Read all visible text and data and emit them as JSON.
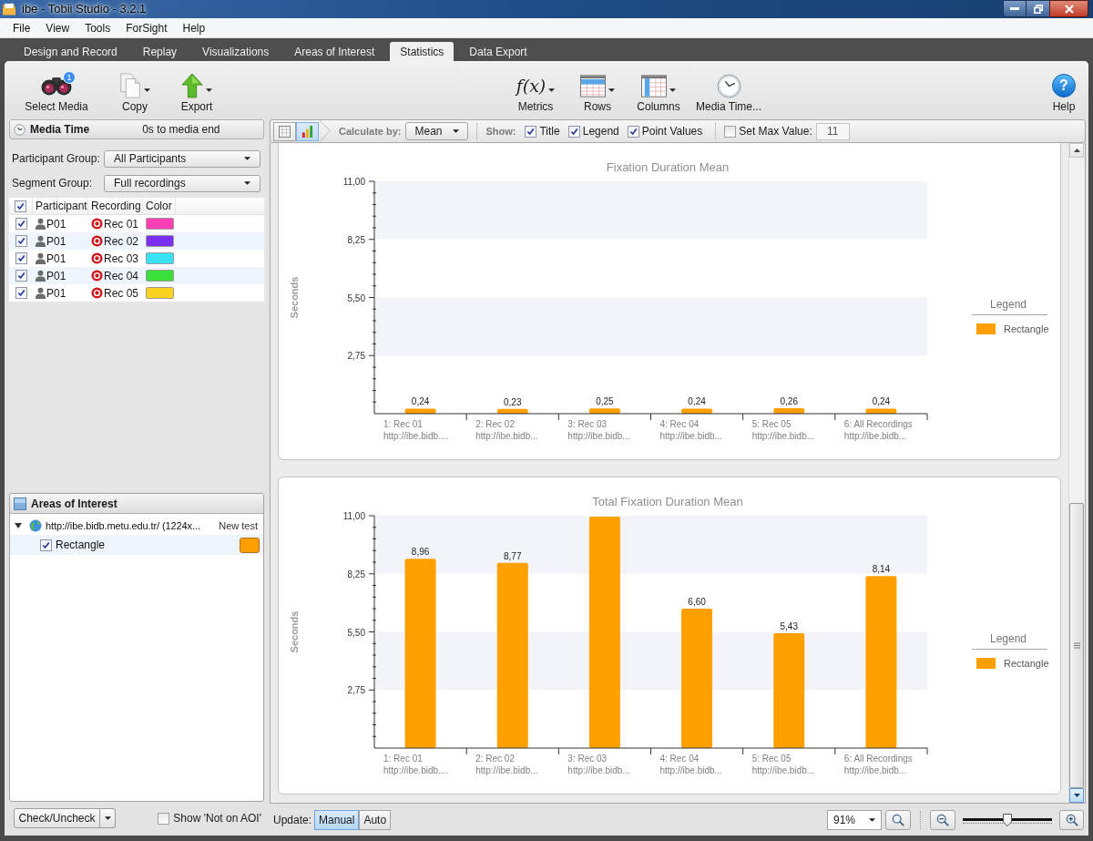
{
  "window": {
    "title": "ibe - Tobii Studio - 3.2.1"
  },
  "menu": [
    "File",
    "View",
    "Tools",
    "ForSight",
    "Help"
  ],
  "tabs": [
    {
      "label": "Design and Record",
      "selected": false
    },
    {
      "label": "Replay",
      "selected": false
    },
    {
      "label": "Visualizations",
      "selected": false
    },
    {
      "label": "Areas of Interest",
      "selected": false
    },
    {
      "label": "Statistics",
      "selected": true
    },
    {
      "label": "Data Export",
      "selected": false
    }
  ],
  "toolbar": {
    "left": [
      {
        "kind": "binoculars",
        "label": "Select Media",
        "badge": "1",
        "dropdown": false
      },
      {
        "kind": "pages",
        "label": "Copy",
        "dropdown": true
      },
      {
        "kind": "up-arrow",
        "label": "Export",
        "dropdown": true
      }
    ],
    "center": [
      {
        "kind": "formula",
        "label": "Metrics",
        "glyph": "f(x)",
        "dropdown": true
      },
      {
        "kind": "rows",
        "label": "Rows",
        "dropdown": true
      },
      {
        "kind": "columns",
        "label": "Columns",
        "dropdown": true
      },
      {
        "kind": "clock",
        "label": "Media Time...",
        "dropdown": false
      }
    ],
    "right": [
      {
        "kind": "help",
        "label": "Help",
        "glyph": "?",
        "dropdown": false
      }
    ]
  },
  "media_time": {
    "title": "Media Time",
    "range": "0s to media end"
  },
  "filters": [
    {
      "label": "Participant Group:",
      "value": "All Participants"
    },
    {
      "label": "Segment Group:",
      "value": "Full recordings"
    }
  ],
  "recordings_table": {
    "all_checked": true,
    "columns": [
      "Participant",
      "Recording",
      "Color"
    ],
    "rows": [
      {
        "checked": true,
        "participant": "P01",
        "recording": "Rec 01",
        "color": "#ff40b4"
      },
      {
        "checked": true,
        "participant": "P01",
        "recording": "Rec 02",
        "color": "#7b2ff0"
      },
      {
        "checked": true,
        "participant": "P01",
        "recording": "Rec 03",
        "color": "#38e4f4"
      },
      {
        "checked": true,
        "participant": "P01",
        "recording": "Rec 04",
        "color": "#3ae03a"
      },
      {
        "checked": true,
        "participant": "P01",
        "recording": "Rec 05",
        "color": "#ffd21e"
      }
    ]
  },
  "aoi_panel": {
    "title": "Areas of Interest",
    "tree": [
      {
        "label": "http://ibe.bidb.metu.edu.tr/ (1224x...",
        "test": "New test",
        "expanded": true,
        "children": [
          {
            "label": "Rectangle",
            "checked": true,
            "selected": true,
            "color": "#ffa000"
          }
        ]
      }
    ]
  },
  "left_footer": {
    "button": "Check/Uncheck",
    "option": {
      "label": "Show 'Not on AOI'",
      "checked": false
    }
  },
  "options_bar": {
    "views": [
      {
        "kind": "table",
        "selected": false
      },
      {
        "kind": "chart",
        "selected": true
      }
    ],
    "calculate_by": {
      "label": "Calculate by:",
      "value": "Mean"
    },
    "show": {
      "label": "Show:",
      "options": [
        {
          "label": "Title",
          "checked": true
        },
        {
          "label": "Legend",
          "checked": true
        },
        {
          "label": "Point Values",
          "checked": true
        }
      ]
    },
    "max_value": {
      "label": "Set Max Value:",
      "checked": false,
      "value": "11"
    }
  },
  "charts": [
    {
      "legend_title": "Legend",
      "chart_data": {
        "type": "bar",
        "title": "Fixation Duration Mean",
        "ylabel": "Seconds",
        "categories": [
          "1: Rec 01\nhttp://ibe.bidb....",
          "2: Rec 02\nhttp://ibe.bidb...",
          "3: Rec 03\nhttp://ibe.bidb...",
          "4: Rec 04\nhttp://ibe.bidb...",
          "5: Rec 05\nhttp://ibe.bidb...",
          "6: All Recordings\nhttp://ibe.bidb..."
        ],
        "series": [
          {
            "name": "Rectangle",
            "color": "#ffa000",
            "values": [
              0.24,
              0.23,
              0.25,
              0.24,
              0.26,
              0.24
            ]
          }
        ],
        "ylim": [
          0,
          11
        ],
        "yticks": [
          {
            "value": 2.75,
            "label": "2,75"
          },
          {
            "value": 5.5,
            "label": "5,50"
          },
          {
            "value": 8.25,
            "label": "8,25"
          },
          {
            "value": 11,
            "label": "11,00"
          }
        ],
        "value_labels": [
          "0,24",
          "0,23",
          "0,25",
          "0,24",
          "0,26",
          "0,24"
        ]
      }
    },
    {
      "legend_title": "Legend",
      "chart_data": {
        "type": "bar",
        "title": "Total Fixation Duration Mean",
        "ylabel": "Seconds",
        "categories": [
          "1: Rec 01\nhttp://ibe.bidb....",
          "2: Rec 02\nhttp://ibe.bidb...",
          "3: Rec 03\nhttp://ibe.bidb...",
          "4: Rec 04\nhttp://ibe.bidb...",
          "5: Rec 05\nhttp://ibe.bidb...",
          "6: All Recordings\nhttp://ibe.bidb..."
        ],
        "series": [
          {
            "name": "Rectangle",
            "color": "#ffa000",
            "values": [
              8.96,
              8.77,
              10.96,
              6.6,
              5.43,
              8.14
            ]
          }
        ],
        "ylim": [
          0,
          11
        ],
        "yticks": [
          {
            "value": 2.75,
            "label": "2,75"
          },
          {
            "value": 5.5,
            "label": "5,50"
          },
          {
            "value": 8.25,
            "label": "8,25"
          },
          {
            "value": 11,
            "label": "11,00"
          }
        ],
        "value_labels": [
          "8,96",
          "8,77",
          null,
          "6,60",
          "5,43",
          "8,14"
        ]
      }
    }
  ],
  "footer": {
    "update_label": "Update:",
    "update_modes": [
      {
        "label": "Manual",
        "selected": true
      },
      {
        "label": "Auto",
        "selected": false
      }
    ],
    "zoom": "91%",
    "zoom_slider": {
      "level": 0.5
    }
  }
}
